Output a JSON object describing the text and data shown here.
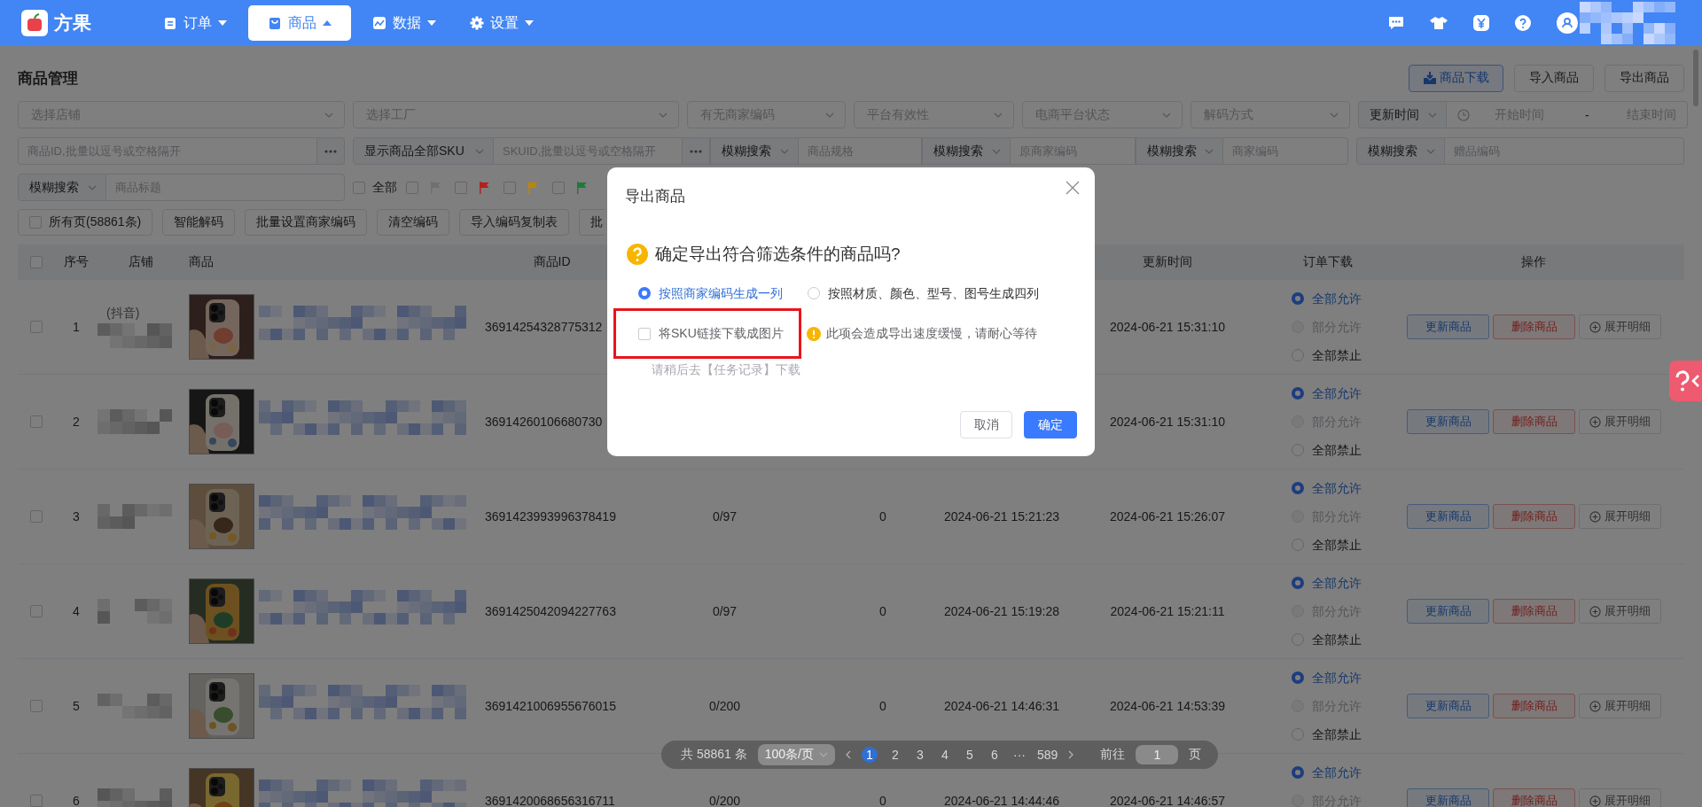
{
  "top_nav": {
    "brand": "方果",
    "items": [
      {
        "label": "订单",
        "selected": false
      },
      {
        "label": "商品",
        "selected": true
      },
      {
        "label": "数据",
        "selected": false
      },
      {
        "label": "设置",
        "selected": false
      }
    ]
  },
  "page_title": "商品管理",
  "page_buttons": [
    {
      "label": "商品下载",
      "kind": "primary"
    },
    {
      "label": "导入商品",
      "kind": "plain"
    },
    {
      "label": "导出商品",
      "kind": "plain"
    }
  ],
  "filters": {
    "row_1": [
      {
        "kind": "select",
        "placeholder": "选择店铺"
      },
      {
        "kind": "select",
        "placeholder": "选择工厂"
      },
      {
        "kind": "select",
        "placeholder": "有无商家编码"
      },
      {
        "kind": "select",
        "placeholder": "平台有效性"
      },
      {
        "kind": "select",
        "placeholder": "电商平台状态"
      },
      {
        "kind": "select",
        "placeholder": "解码方式"
      },
      {
        "kind": "date_range",
        "mode": "更新时间",
        "start_placeholder": "开始时间",
        "separator": "-",
        "end_placeholder": "结束时间"
      }
    ],
    "row_2": [
      {
        "kind": "input_more",
        "placeholder": "商品ID,批量以逗号或空格隔开"
      },
      {
        "kind": "mode_input_more",
        "mode": "显示商品全部SKU",
        "placeholder": "SKUID,批量以逗号或空格隔开"
      },
      {
        "kind": "mode_input",
        "mode": "模糊搜索",
        "placeholder": "商品规格"
      },
      {
        "kind": "mode_input",
        "mode": "模糊搜索",
        "placeholder": "原商家编码"
      },
      {
        "kind": "mode_input",
        "mode": "模糊搜索",
        "placeholder": "商家编码"
      },
      {
        "kind": "mode_input",
        "mode": "模糊搜索",
        "placeholder": "赠品编码"
      }
    ],
    "row_3": [
      {
        "kind": "mode_input",
        "mode": "模糊搜索",
        "placeholder": "商品标题"
      }
    ],
    "flag_filter": {
      "all": {
        "label": "全部",
        "checked": false
      },
      "flags": [
        {
          "color": "#707070",
          "checked": false
        },
        {
          "color": "#b3201f",
          "checked": false
        },
        {
          "color": "#b8860b",
          "checked": false
        },
        {
          "color": "#1e7a3c",
          "checked": false
        }
      ]
    }
  },
  "toolbar": [
    {
      "kind": "checkbox",
      "label": "所有页(58861条)",
      "checked": false
    },
    {
      "kind": "button",
      "label": "智能解码"
    },
    {
      "kind": "button",
      "label": "批量设置商家编码"
    },
    {
      "kind": "button",
      "label": "清空编码"
    },
    {
      "kind": "button",
      "label": "导入编码复制表"
    },
    {
      "kind": "button",
      "label": "批"
    }
  ],
  "table": {
    "select_all_checked": false,
    "columns": [
      "序号",
      "店铺",
      "商品",
      "商品ID",
      "更新时间",
      "订单下载",
      "操作"
    ],
    "rows": [
      {
        "checked": false,
        "index": "1",
        "shop": "(抖音)",
        "image": {
          "kind": "picture"
        },
        "product_id": "36914254328775312",
        "updated": "2024-06-21 15:31:10",
        "order_download": [
          {
            "label": "全部允许",
            "selected": true,
            "disabled": false
          },
          {
            "label": "部分允许",
            "selected": false,
            "disabled": true
          },
          {
            "label": "全部禁止",
            "selected": false,
            "disabled": false
          }
        ],
        "actions": [
          {
            "kind": "update",
            "label": "更新商品"
          },
          {
            "kind": "delete",
            "label": "删除商品"
          },
          {
            "kind": "expand",
            "label": "展开明细"
          }
        ]
      },
      {
        "checked": false,
        "index": "2",
        "image": {
          "kind": "picture"
        },
        "product_id": "36914260106680730",
        "updated": "2024-06-21 15:31:10",
        "order_download": [
          {
            "label": "全部允许",
            "selected": true,
            "disabled": false
          },
          {
            "label": "部分允许",
            "selected": false,
            "disabled": true
          },
          {
            "label": "全部禁止",
            "selected": false,
            "disabled": false
          }
        ],
        "actions": [
          {
            "kind": "update",
            "label": "更新商品"
          },
          {
            "kind": "delete",
            "label": "删除商品"
          },
          {
            "kind": "expand",
            "label": "展开明细"
          }
        ]
      },
      {
        "checked": false,
        "index": "3",
        "image": {
          "kind": "picture"
        },
        "product_id": "3691423993996378419",
        "column_5": "0/97",
        "column_6": "0",
        "column_7": "2024-06-21 15:21:23",
        "updated": "2024-06-21 15:26:07",
        "order_download": [
          {
            "label": "全部允许",
            "selected": true,
            "disabled": false
          },
          {
            "label": "部分允许",
            "selected": false,
            "disabled": true
          },
          {
            "label": "全部禁止",
            "selected": false,
            "disabled": false
          }
        ],
        "actions": [
          {
            "kind": "update",
            "label": "更新商品"
          },
          {
            "kind": "delete",
            "label": "删除商品"
          },
          {
            "kind": "expand",
            "label": "展开明细"
          }
        ]
      },
      {
        "checked": false,
        "index": "4",
        "image": {
          "kind": "picture"
        },
        "product_id": "3691425042094227763",
        "column_5": "0/97",
        "column_6": "0",
        "column_7": "2024-06-21 15:19:28",
        "updated": "2024-06-21 15:21:11",
        "order_download": [
          {
            "label": "全部允许",
            "selected": true,
            "disabled": false
          },
          {
            "label": "部分允许",
            "selected": false,
            "disabled": true
          },
          {
            "label": "全部禁止",
            "selected": false,
            "disabled": false
          }
        ],
        "actions": [
          {
            "kind": "update",
            "label": "更新商品"
          },
          {
            "kind": "delete",
            "label": "删除商品"
          },
          {
            "kind": "expand",
            "label": "展开明细"
          }
        ]
      },
      {
        "checked": false,
        "index": "5",
        "image": {
          "kind": "picture"
        },
        "product_id": "3691421006955676015",
        "column_5": "0/200",
        "column_6": "0",
        "column_7": "2024-06-21 14:46:31",
        "updated": "2024-06-21 14:53:39",
        "order_download": [
          {
            "label": "全部允许",
            "selected": true,
            "disabled": false
          },
          {
            "label": "部分允许",
            "selected": false,
            "disabled": true
          },
          {
            "label": "全部禁止",
            "selected": false,
            "disabled": false
          }
        ],
        "actions": [
          {
            "kind": "update",
            "label": "更新商品"
          },
          {
            "kind": "delete",
            "label": "删除商品"
          },
          {
            "kind": "expand",
            "label": "展开明细"
          }
        ]
      },
      {
        "checked": false,
        "index": "6",
        "image": {
          "kind": "picture"
        },
        "product_id": "3691420068656316711",
        "column_5": "0/200",
        "column_6": "0",
        "column_7": "2024-06-21 14:44:46",
        "updated": "2024-06-21 14:46:57",
        "order_download": [
          {
            "label": "全部允许",
            "selected": true,
            "disabled": false
          },
          {
            "label": "部分允许",
            "selected": false,
            "disabled": true
          }
        ],
        "actions": [
          {
            "kind": "update",
            "label": "更新商品"
          },
          {
            "kind": "delete",
            "label": "删除商品"
          },
          {
            "kind": "expand",
            "label": "展开明细"
          }
        ]
      }
    ]
  },
  "pagination": {
    "total": "共 58861 条",
    "page_size": "100条/页",
    "pages": [
      {
        "label": "1",
        "selected": true
      },
      {
        "label": "2",
        "selected": false
      },
      {
        "label": "3",
        "selected": false
      },
      {
        "label": "4",
        "selected": false
      },
      {
        "label": "5",
        "selected": false
      },
      {
        "label": "6",
        "selected": false
      },
      {
        "label": "···",
        "selected": false
      },
      {
        "label": "589",
        "selected": false
      }
    ],
    "goto_label": "前往",
    "goto_value": "1",
    "goto_suffix": "页"
  },
  "dialog": {
    "title": "导出商品",
    "question": "确定导出符合筛选条件的商品吗?",
    "options": [
      {
        "label": "按照商家编码生成一列",
        "selected": true
      },
      {
        "label": "按照材质、颜色、型号、图号生成四列",
        "selected": false
      }
    ],
    "image_option": {
      "label": "将SKU链接下载成图片",
      "checked": false,
      "highlighted": true
    },
    "warning": "此项会造成导出速度缓慢，请耐心等待",
    "hint": "请稍后去【任务记录】下载",
    "buttons": [
      {
        "label": "取消",
        "kind": "default"
      },
      {
        "label": "确定",
        "kind": "primary"
      }
    ]
  }
}
